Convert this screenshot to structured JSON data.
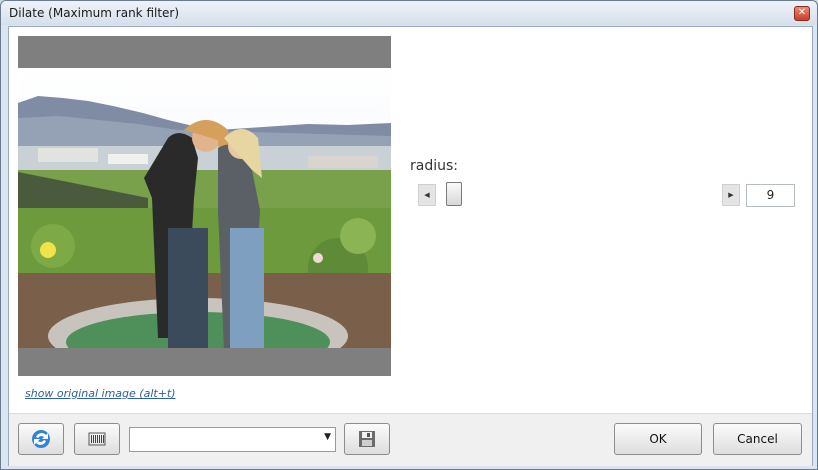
{
  "window": {
    "title": "Dilate (Maximum rank filter)",
    "close_glyph": "✕"
  },
  "preview": {
    "show_original_label": "show original image (alt+t)"
  },
  "filter": {
    "param_label": "radius:",
    "value": "9",
    "slider_value": 9,
    "left_arrow": "◀",
    "right_arrow": "▶"
  },
  "toolbar": {
    "refresh_icon": "refresh-icon",
    "barcode_icon": "barcode-icon",
    "preset_value": "",
    "combo_arrow": "▼",
    "save_icon": "save-icon"
  },
  "buttons": {
    "ok": "OK",
    "cancel": "Cancel"
  },
  "colors": {
    "link": "#2e5f9e",
    "refresh": "#2f84d8"
  }
}
